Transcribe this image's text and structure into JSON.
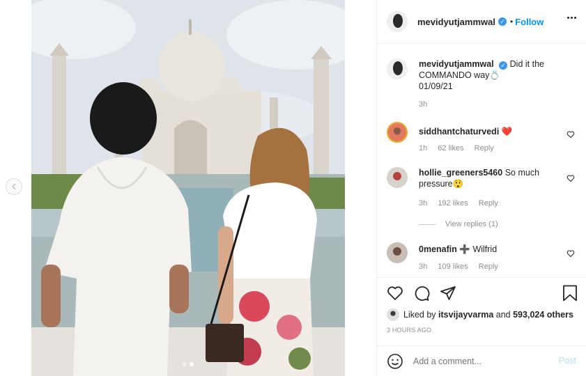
{
  "post": {
    "username": "mevidyutjammwal",
    "follow_label": "Follow",
    "separator": "•",
    "caption_text": "Did it the COMMANDO way",
    "caption_emoji": "💍",
    "caption_date": "01/09/21",
    "caption_time": "3h",
    "carousel_count": 2,
    "carousel_active": 2
  },
  "comments": [
    {
      "username": "siddhantchaturvedi",
      "text": "",
      "emoji": "❤️",
      "time": "1h",
      "likes": "62 likes",
      "reply": "Reply"
    },
    {
      "username": "hollie_greeners5460",
      "text": "So much pressure",
      "emoji": "😲",
      "time": "3h",
      "likes": "192 likes",
      "reply": "Reply"
    },
    {
      "username": "0menafin",
      "text": "Wilfrid",
      "emoji": "➕",
      "time": "3h",
      "likes": "109 likes",
      "reply": "Reply"
    }
  ],
  "view_replies": "View replies (1)",
  "likes": {
    "prefix": "Liked by",
    "user": "itsvijayvarma",
    "and": "and",
    "others": "593,024 others"
  },
  "time_ago": "3 HOURS AGO",
  "add_comment": {
    "placeholder": "Add a comment...",
    "post_label": "Post"
  },
  "icons": {
    "verified": "verified-badge-icon",
    "more": "more-options-icon",
    "like": "heart-icon",
    "comment": "comment-icon",
    "share": "share-icon",
    "save": "bookmark-icon",
    "emoji": "emoji-icon",
    "prev": "chevron-left-icon"
  },
  "colors": {
    "accent": "#0095f6",
    "verified": "#3897f0",
    "muted": "#8e8e8e",
    "heart": "#ed4956"
  }
}
